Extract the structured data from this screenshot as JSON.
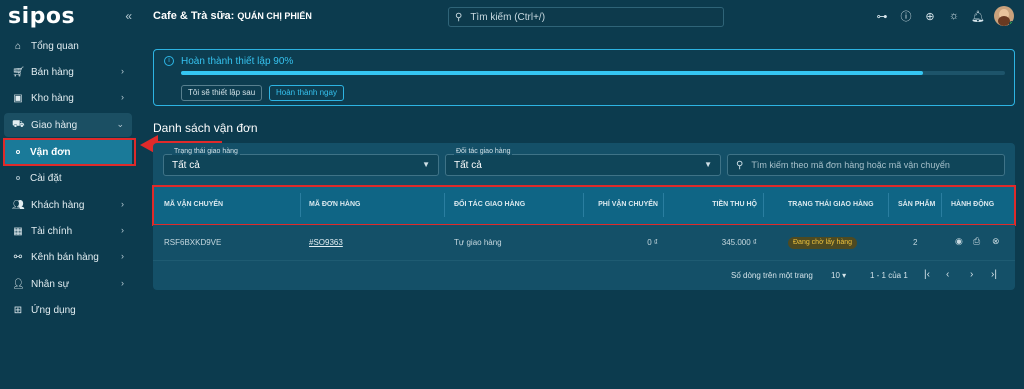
{
  "brand": {
    "logo_text": "sipos",
    "collapse_icon": "double-chevron-left-icon"
  },
  "sidebar": {
    "items": [
      {
        "label": "Tổng quan",
        "icon": "home-icon",
        "has_chevron": false
      },
      {
        "label": "Bán hàng",
        "icon": "cart-icon",
        "has_chevron": true
      },
      {
        "label": "Kho hàng",
        "icon": "warehouse-icon",
        "has_chevron": true
      },
      {
        "label": "Giao hàng",
        "icon": "truck-icon",
        "has_chevron": true,
        "expanded": true,
        "children": [
          {
            "label": "Vận đơn",
            "active": true
          },
          {
            "label": "Cài đặt",
            "active": false
          }
        ]
      },
      {
        "label": "Khách hàng",
        "icon": "users-icon",
        "has_chevron": true
      },
      {
        "label": "Tài chính",
        "icon": "calculator-icon",
        "has_chevron": true
      },
      {
        "label": "Kênh bán hàng",
        "icon": "channels-icon",
        "has_chevron": true
      },
      {
        "label": "Nhân sự",
        "icon": "staff-icon",
        "has_chevron": true
      },
      {
        "label": "Ứng dụng",
        "icon": "apps-icon",
        "has_chevron": false
      }
    ]
  },
  "header": {
    "shop_prefix": "Cafe & Trà sữa: ",
    "shop_name": "QUÁN CHỊ PHIẾN",
    "search_placeholder": "Tìm kiếm (Ctrl+/)",
    "icons": [
      "sitemap-icon",
      "help-icon",
      "globe-icon",
      "theme-sun-icon",
      "bell-icon"
    ]
  },
  "setup": {
    "title": "Hoàn thành thiết lập 90%",
    "progress": 0.9,
    "later_label": "Tôi sẽ thiết lập sau",
    "done_label": "Hoàn thành ngay"
  },
  "page": {
    "title": "Danh sách vận đơn"
  },
  "filters": {
    "status": {
      "label": "Trạng thái giao hàng",
      "value": "Tất cả"
    },
    "partner": {
      "label": "Đối tác giao hàng",
      "value": "Tất cả"
    },
    "search_placeholder": "Tìm kiếm theo mã đơn hàng hoặc mã vận chuyển"
  },
  "table": {
    "columns": [
      "MÃ VẬN CHUYỂN",
      "MÃ ĐƠN HÀNG",
      "ĐỐI TÁC GIAO HÀNG",
      "PHÍ VẬN CHUYỂN",
      "TIỀN THU HỘ",
      "TRẠNG THÁI GIAO HÀNG",
      "SẢN PHẨM",
      "HÀNH ĐỘNG"
    ],
    "rows": [
      {
        "shipping_code": "RSF6BXKD9VE",
        "order_code": "#SO9363",
        "partner": "Tự giao hàng",
        "fee": "0 ₫",
        "cod": "345.000 ₫",
        "status": "Đang chờ lấy hàng",
        "products": "2"
      }
    ],
    "row_actions": [
      "eye-icon",
      "printer-icon",
      "cancel-circle-icon"
    ]
  },
  "pagination": {
    "rows_per_page_label": "Số dòng trên một trang",
    "rows_per_page": "10",
    "range": "1 - 1 của 1"
  },
  "colors": {
    "accent": "#2db4e3",
    "highlight": "#e02a2a",
    "badge_warning": "#f1c33c"
  }
}
